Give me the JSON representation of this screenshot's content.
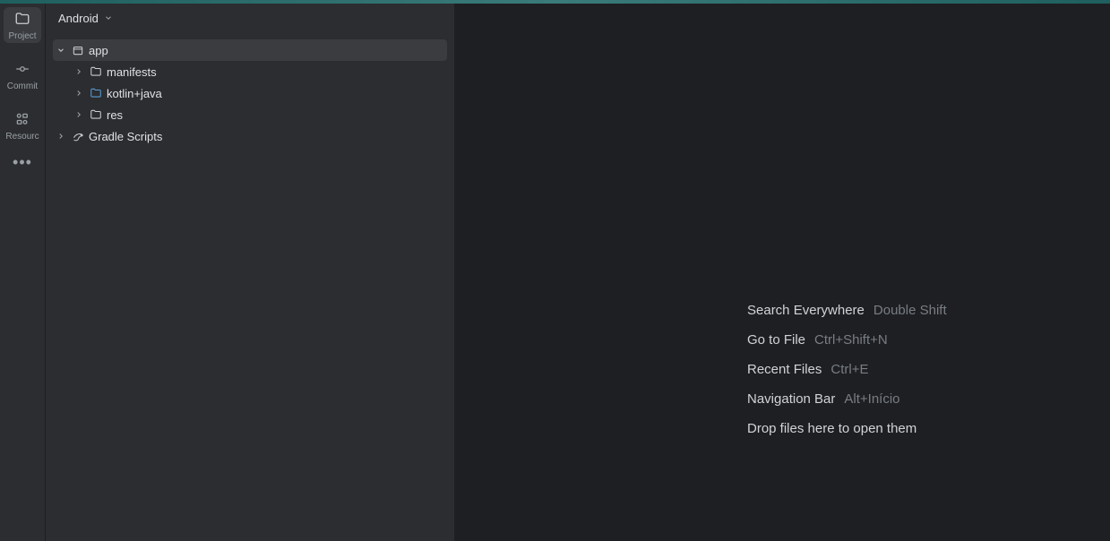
{
  "rail": {
    "project": "Project",
    "commit": "Commit",
    "resource": "Resourc"
  },
  "panel": {
    "viewLabel": "Android"
  },
  "tree": {
    "app": "app",
    "manifests": "manifests",
    "kotlinjava": "kotlin+java",
    "res": "res",
    "gradle": "Gradle Scripts"
  },
  "hints": {
    "searchEverywhere": {
      "label": "Search Everywhere",
      "key": "Double Shift"
    },
    "goToFile": {
      "label": "Go to File",
      "key": "Ctrl+Shift+N"
    },
    "recentFiles": {
      "label": "Recent Files",
      "key": "Ctrl+E"
    },
    "navBar": {
      "label": "Navigation Bar",
      "key": "Alt+Início"
    },
    "drop": "Drop files here to open them"
  }
}
